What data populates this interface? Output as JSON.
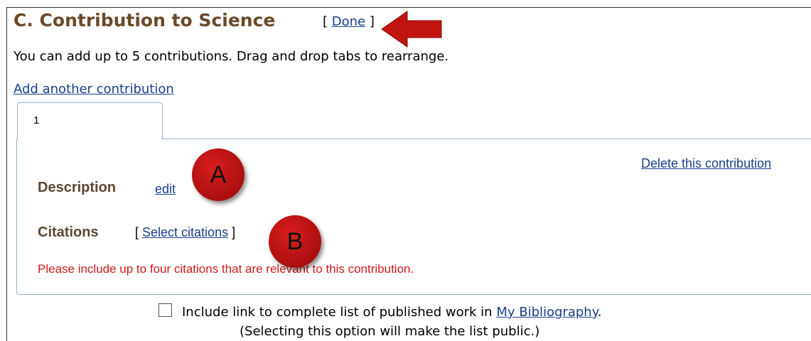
{
  "section": {
    "title": "C. Contribution to Science",
    "done_link": "Done",
    "bracket_open": "[ ",
    "bracket_close": " ]"
  },
  "instructions": "You can add up to 5 contributions. Drag and drop tabs to rearrange.",
  "add_link": "Add another contribution",
  "tabs": [
    {
      "label": "1"
    }
  ],
  "panel": {
    "delete_link": "Delete this contribution",
    "description_label": "Description",
    "edit_link": "edit",
    "citations_label": "Citations",
    "select_citations_link": "Select citations",
    "citations_note": "Please include up to four citations that are relevant to this contribution."
  },
  "annotations": {
    "a": "A",
    "b": "B",
    "arrow_color": "#c0140f"
  },
  "bibliography": {
    "checkbox_text": "Include link to complete list of published work in ",
    "link_text": "My Bibliography",
    "period": ".",
    "note": "(Selecting this option will make the list public.)",
    "checked": false
  },
  "colors": {
    "title": "#6b4a2b",
    "link": "#1a3e8c",
    "warning": "#cc1a1a",
    "panel_border": "#9bb3cc"
  }
}
